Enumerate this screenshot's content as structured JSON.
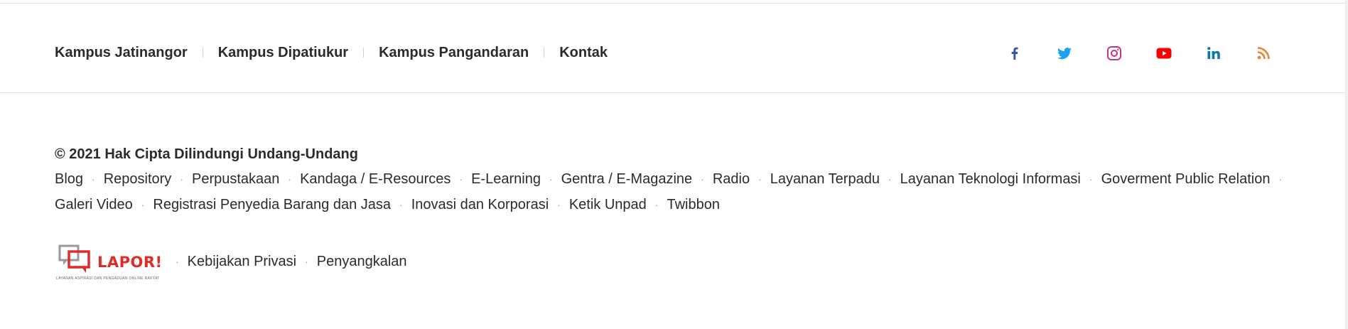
{
  "campus_nav": {
    "items": [
      {
        "label": "Kampus Jatinangor"
      },
      {
        "label": "Kampus Dipatiukur"
      },
      {
        "label": "Kampus Pangandaran"
      },
      {
        "label": "Kontak"
      }
    ]
  },
  "social": {
    "items": [
      {
        "icon": "facebook-icon",
        "color": "#3b5998"
      },
      {
        "icon": "twitter-icon",
        "color": "#1da1f2"
      },
      {
        "icon": "instagram-icon",
        "color": "#c13584"
      },
      {
        "icon": "youtube-icon",
        "color": "#ff0000"
      },
      {
        "icon": "linkedin-icon",
        "color": "#0e76a8"
      },
      {
        "icon": "rss-icon",
        "color": "#ee802f"
      }
    ]
  },
  "footer": {
    "copyright": "© 2021 Hak Cipta Dilindungi Undang-Undang",
    "links_row1": [
      "Blog",
      "Repository",
      "Perpustakaan",
      "Kandaga / E-Resources",
      "E-Learning",
      "Gentra / E-Magazine",
      "Radio",
      "Layanan Terpadu",
      "Layanan Teknologi Informasi",
      "Goverment Public Relation"
    ],
    "links_row2": [
      "Galeri Video",
      "Registrasi Penyedia Barang dan Jasa",
      "Inovasi dan Korporasi",
      "Ketik Unpad",
      "Twibbon"
    ],
    "lapor": {
      "wordmark": "LAPOR!",
      "tagline": "LAYANAN ASPIRASI DAN PENGADUAN ONLINE RAKYAT"
    },
    "legal_links": [
      "Kebijakan Privasi",
      "Penyangkalan"
    ],
    "separator": "·"
  },
  "colors": {
    "text": "#2b2b2b",
    "divider": "#e2e2e2",
    "lapor_red": "#e02b2b"
  }
}
